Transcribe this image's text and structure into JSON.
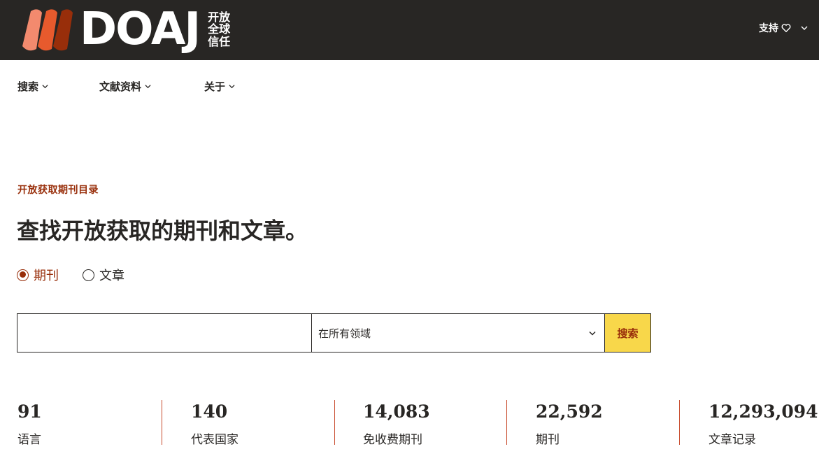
{
  "header": {
    "logo_text": "DOAJ",
    "tagline": [
      "开放",
      "全球",
      "信任"
    ],
    "support_label": "支持",
    "brand_colors": [
      "#f38a6e",
      "#e75a2d",
      "#982e0a"
    ]
  },
  "nav": {
    "items": [
      {
        "label": "搜索"
      },
      {
        "label": "文献资料"
      },
      {
        "label": "关于"
      }
    ]
  },
  "hero": {
    "eyebrow": "开放获取期刊目录",
    "headline": "查找开放获取的期刊和文章。",
    "radios": [
      {
        "label": "期刊",
        "checked": true
      },
      {
        "label": "文章",
        "checked": false
      }
    ]
  },
  "search": {
    "input_value": "",
    "select_value": "在所有领域",
    "button_label": "搜索"
  },
  "stats": [
    {
      "value": "91",
      "label": "语言"
    },
    {
      "value": "140",
      "label": "代表国家"
    },
    {
      "value": "14,083",
      "label": "免收费期刊"
    },
    {
      "value": "22,592",
      "label": "期刊"
    },
    {
      "value": "12,293,094",
      "label": "文章记录"
    }
  ],
  "colors": {
    "dark": "#282624",
    "accent": "#982e0a",
    "button": "#f8d74a",
    "divider": "#c84a2c"
  }
}
